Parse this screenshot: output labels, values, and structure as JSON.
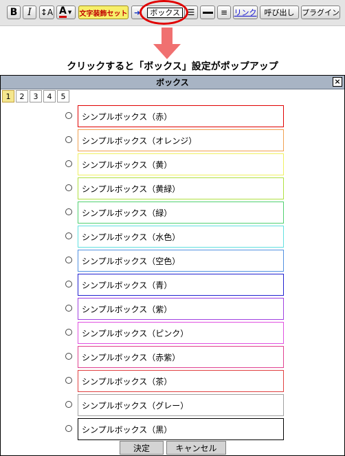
{
  "toolbar": {
    "bold": "B",
    "italic": "I",
    "font_size": "A",
    "font_color": "A",
    "decoration": "文字装飾セット",
    "box": "ボックス",
    "link": "リンク",
    "call": "呼び出し",
    "plugin": "プラグイン"
  },
  "caption": "クリックすると「ボックス」設定がポップアップ",
  "dialog": {
    "title": "ボックス",
    "close": "×",
    "tabs": [
      "1",
      "2",
      "3",
      "4",
      "5"
    ],
    "active_tab": "1",
    "options": [
      {
        "label": "シンプルボックス（赤）",
        "color": "#e00000"
      },
      {
        "label": "シンプルボックス（オレンジ）",
        "color": "#f0a050"
      },
      {
        "label": "シンプルボックス（黄）",
        "color": "#f0f060"
      },
      {
        "label": "シンプルボックス（黄緑）",
        "color": "#b0e040"
      },
      {
        "label": "シンプルボックス（緑）",
        "color": "#50d070"
      },
      {
        "label": "シンプルボックス（水色）",
        "color": "#60e0e0"
      },
      {
        "label": "シンプルボックス（空色）",
        "color": "#5090e0"
      },
      {
        "label": "シンプルボックス（青）",
        "color": "#2020d0"
      },
      {
        "label": "シンプルボックス（紫）",
        "color": "#a040e0"
      },
      {
        "label": "シンプルボックス（ピンク）",
        "color": "#e050e0"
      },
      {
        "label": "シンプルボックス（赤紫）",
        "color": "#e04090"
      },
      {
        "label": "シンプルボックス（茶）",
        "color": "#e04040"
      },
      {
        "label": "シンプルボックス（グレー）",
        "color": "#a0a0a0"
      },
      {
        "label": "シンプルボックス（黒）",
        "color": "#000000"
      }
    ],
    "ok": "決定",
    "cancel": "キャンセル"
  },
  "colors": {
    "annotation_ring": "#e00000",
    "arrow": "#f07070",
    "titlebar": "#a8b4c4"
  }
}
